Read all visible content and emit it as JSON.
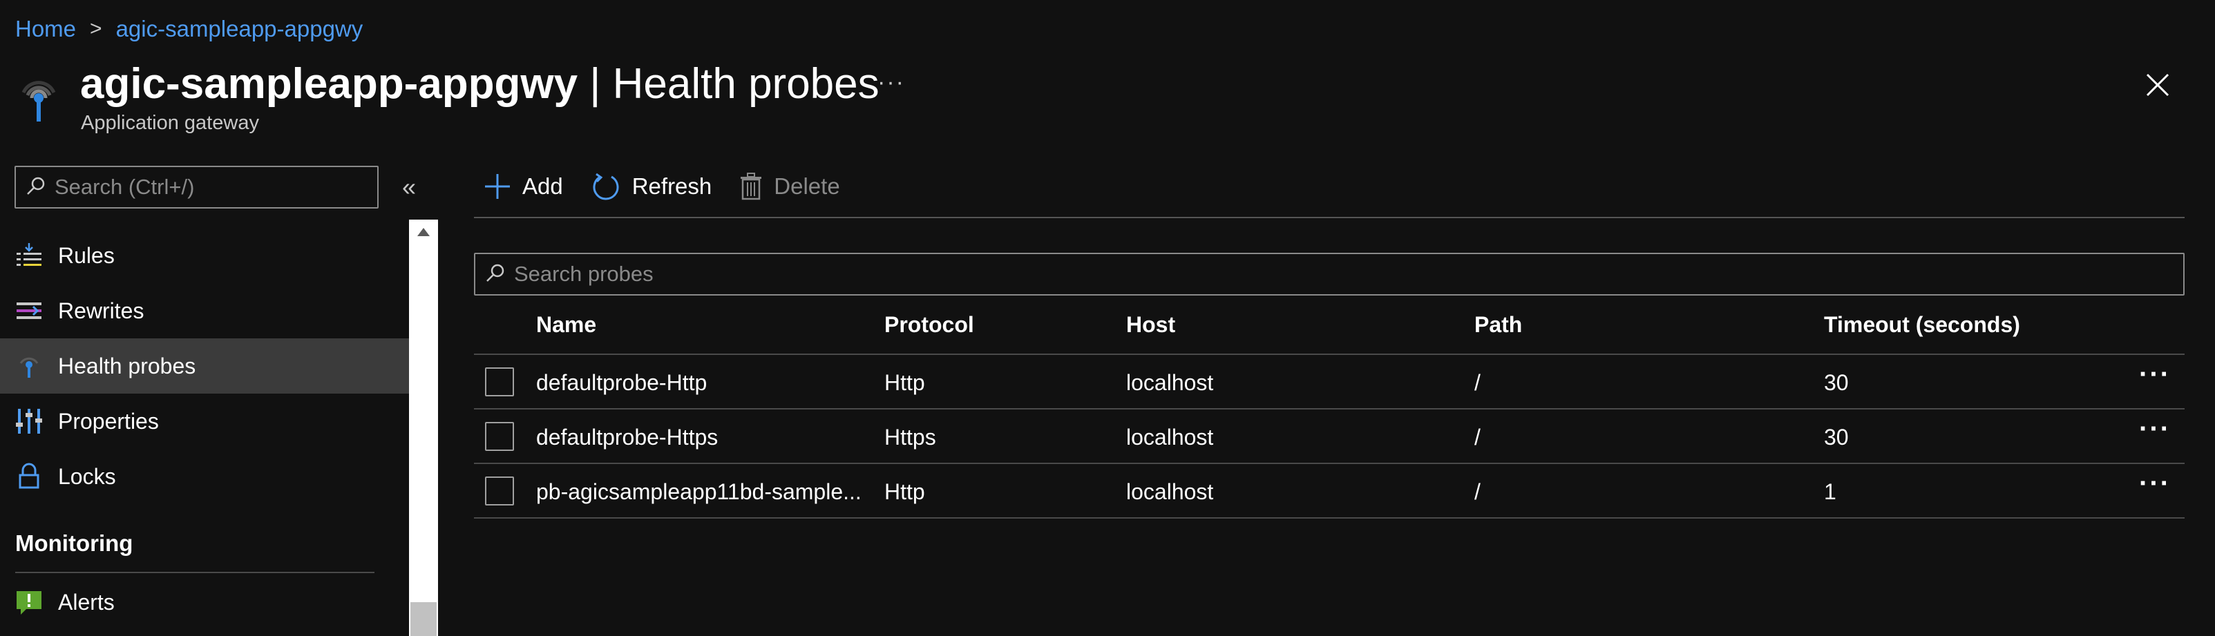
{
  "breadcrumb": {
    "home": "Home",
    "separator": ">",
    "current": "agic-sampleapp-appgwy"
  },
  "header": {
    "resource_name": "agic-sampleapp-appgwy",
    "separator": " | ",
    "page": "Health probes",
    "subtitle": "Application gateway",
    "more": "···"
  },
  "sidebar": {
    "search_placeholder": "Search (Ctrl+/)",
    "collapse": "«",
    "items": [
      {
        "label": "Rules",
        "icon": "rules-icon"
      },
      {
        "label": "Rewrites",
        "icon": "rewrites-icon"
      },
      {
        "label": "Health probes",
        "icon": "health-probe-icon",
        "active": true
      },
      {
        "label": "Properties",
        "icon": "properties-icon"
      },
      {
        "label": "Locks",
        "icon": "lock-icon"
      }
    ],
    "section_monitoring": "Monitoring",
    "monitoring_items": [
      {
        "label": "Alerts",
        "icon": "alert-icon"
      }
    ]
  },
  "toolbar": {
    "add": "Add",
    "refresh": "Refresh",
    "delete": "Delete"
  },
  "probes": {
    "search_placeholder": "Search probes",
    "columns": [
      "Name",
      "Protocol",
      "Host",
      "Path",
      "Timeout (seconds)"
    ],
    "rows": [
      {
        "name": "defaultprobe-Http",
        "protocol": "Http",
        "host": "localhost",
        "path": "/",
        "timeout": "30"
      },
      {
        "name": "defaultprobe-Https",
        "protocol": "Https",
        "host": "localhost",
        "path": "/",
        "timeout": "30"
      },
      {
        "name": "pb-agicsampleapp11bd-sample...",
        "protocol": "Http",
        "host": "localhost",
        "path": "/",
        "timeout": "1"
      }
    ],
    "row_more": "···"
  },
  "colors": {
    "link": "#4f9bf0",
    "background": "#111111",
    "active_item": "#3b3b3b"
  }
}
